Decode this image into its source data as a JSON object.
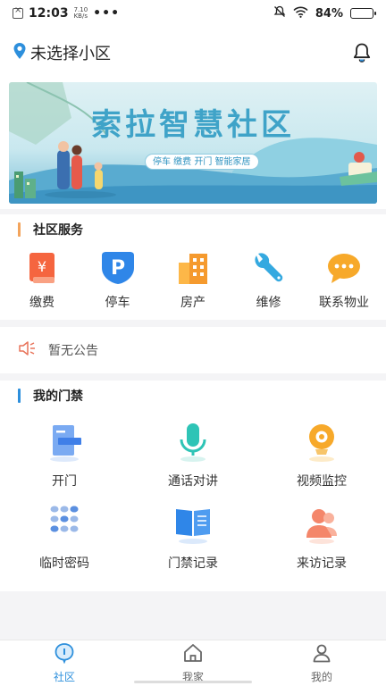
{
  "status_bar": {
    "time": "12:03",
    "speed_value": "7.10",
    "speed_unit": "KB/s",
    "dots": "•••",
    "battery": "84%",
    "battery_level": 0.84
  },
  "header": {
    "location_text": "未选择小区"
  },
  "banner": {
    "title": "索拉智慧社区",
    "tags": "停车  缴费  开门  智能家居"
  },
  "services": {
    "title": "社区服务",
    "accent": "#f3a45c",
    "items": [
      {
        "label": "缴费",
        "icon": "payment-icon"
      },
      {
        "label": "停车",
        "icon": "parking-icon"
      },
      {
        "label": "房产",
        "icon": "building-icon"
      },
      {
        "label": "维修",
        "icon": "wrench-icon"
      },
      {
        "label": "联系物业",
        "icon": "chat-icon"
      }
    ]
  },
  "notice": {
    "text": "暂无公告"
  },
  "door": {
    "title": "我的门禁",
    "accent": "#2d8fdc",
    "items": [
      {
        "label": "开门",
        "icon": "door-icon"
      },
      {
        "label": "通话对讲",
        "icon": "microphone-icon"
      },
      {
        "label": "视频监控",
        "icon": "camera-icon"
      },
      {
        "label": "临时密码",
        "icon": "keypad-icon"
      },
      {
        "label": "门禁记录",
        "icon": "book-icon"
      },
      {
        "label": "来访记录",
        "icon": "visitor-icon"
      }
    ]
  },
  "tabbar": {
    "tabs": [
      {
        "label": "社区",
        "icon": "community-icon",
        "active": true
      },
      {
        "label": "我家",
        "icon": "home-icon",
        "active": false
      },
      {
        "label": "我的",
        "icon": "profile-icon",
        "active": false
      }
    ]
  }
}
